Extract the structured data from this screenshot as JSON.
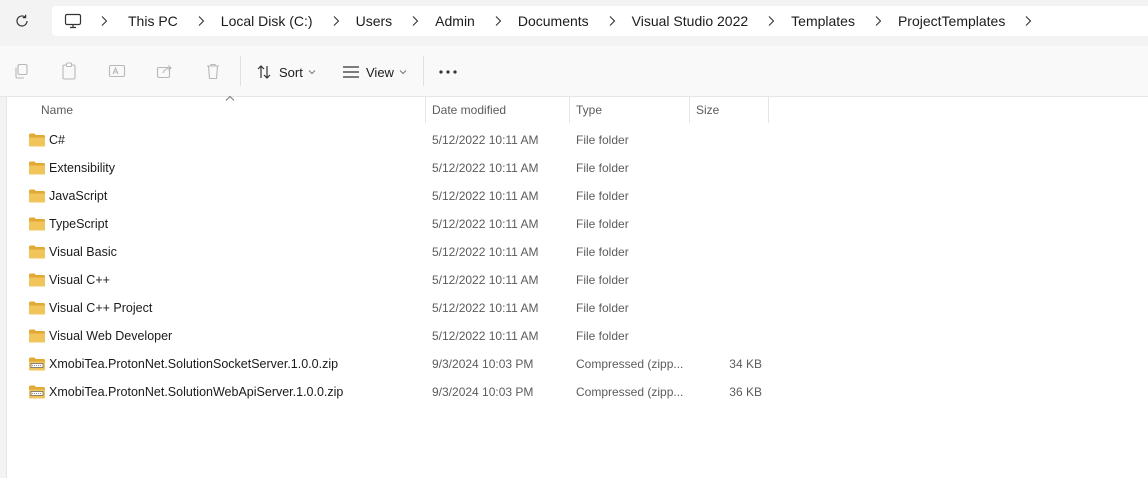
{
  "breadcrumb": [
    "This PC",
    "Local Disk (C:)",
    "Users",
    "Admin",
    "Documents",
    "Visual Studio 2022",
    "Templates",
    "ProjectTemplates"
  ],
  "toolbar": {
    "sort_label": "Sort",
    "view_label": "View"
  },
  "columns": {
    "name": "Name",
    "date": "Date modified",
    "type": "Type",
    "size": "Size"
  },
  "files": [
    {
      "name": "C#",
      "date": "5/12/2022 10:11 AM",
      "type": "File folder",
      "size": "",
      "icon": "folder-icon"
    },
    {
      "name": "Extensibility",
      "date": "5/12/2022 10:11 AM",
      "type": "File folder",
      "size": "",
      "icon": "folder-icon"
    },
    {
      "name": "JavaScript",
      "date": "5/12/2022 10:11 AM",
      "type": "File folder",
      "size": "",
      "icon": "folder-icon"
    },
    {
      "name": "TypeScript",
      "date": "5/12/2022 10:11 AM",
      "type": "File folder",
      "size": "",
      "icon": "folder-icon"
    },
    {
      "name": "Visual Basic",
      "date": "5/12/2022 10:11 AM",
      "type": "File folder",
      "size": "",
      "icon": "folder-icon"
    },
    {
      "name": "Visual C++",
      "date": "5/12/2022 10:11 AM",
      "type": "File folder",
      "size": "",
      "icon": "folder-icon"
    },
    {
      "name": "Visual C++ Project",
      "date": "5/12/2022 10:11 AM",
      "type": "File folder",
      "size": "",
      "icon": "folder-icon"
    },
    {
      "name": "Visual Web Developer",
      "date": "5/12/2022 10:11 AM",
      "type": "File folder",
      "size": "",
      "icon": "folder-icon"
    },
    {
      "name": "XmobiTea.ProtonNet.SolutionSocketServer.1.0.0.zip",
      "date": "9/3/2024 10:03 PM",
      "type": "Compressed (zipp...",
      "size": "34 KB",
      "icon": "zip-folder-icon"
    },
    {
      "name": "XmobiTea.ProtonNet.SolutionWebApiServer.1.0.0.zip",
      "date": "9/3/2024 10:03 PM",
      "type": "Compressed (zipp...",
      "size": "36 KB",
      "icon": "zip-folder-icon"
    }
  ],
  "colors": {
    "folder": "#f2c45c",
    "folder_tab": "#e3a935",
    "window_bg": "#f3f3f3"
  }
}
